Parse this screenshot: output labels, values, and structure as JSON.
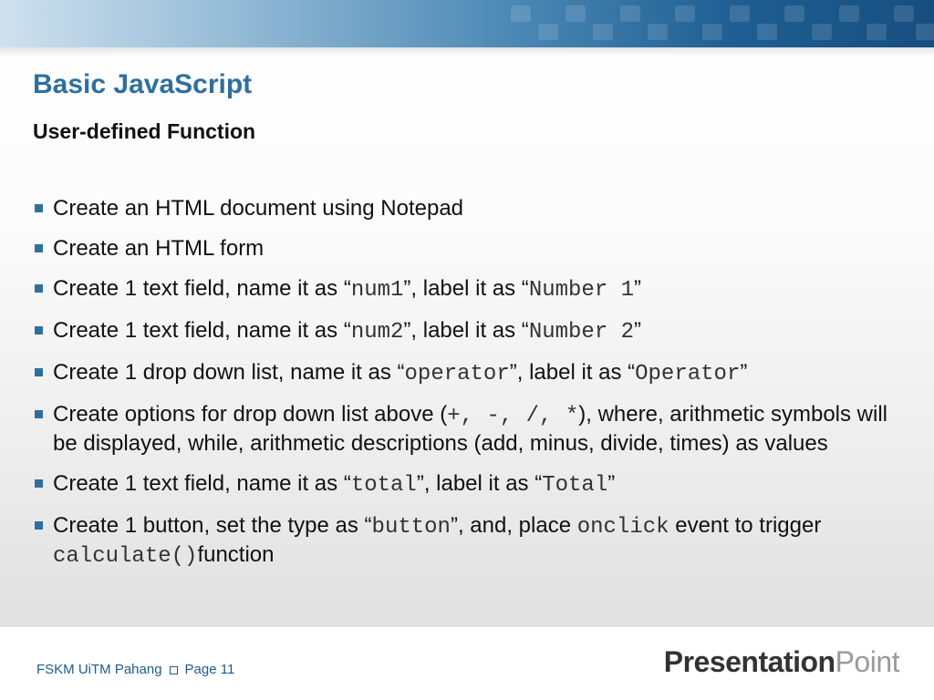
{
  "slide": {
    "title": "Basic JavaScript",
    "subtitle": "User-defined Function",
    "bullets": [
      {
        "segments": [
          {
            "t": "Create an HTML document using Notepad"
          }
        ]
      },
      {
        "segments": [
          {
            "t": "Create an HTML form"
          }
        ]
      },
      {
        "segments": [
          {
            "t": "Create 1 text field, name it as “"
          },
          {
            "t": "num1",
            "code": true
          },
          {
            "t": "”, label it as “"
          },
          {
            "t": "Number 1",
            "code": true
          },
          {
            "t": "”"
          }
        ]
      },
      {
        "segments": [
          {
            "t": "Create 1 text field, name it as “"
          },
          {
            "t": "num2",
            "code": true
          },
          {
            "t": "”, label it as “"
          },
          {
            "t": "Number 2",
            "code": true
          },
          {
            "t": "”"
          }
        ]
      },
      {
        "segments": [
          {
            "t": "Create 1 drop down list, name it as “"
          },
          {
            "t": "operator",
            "code": true
          },
          {
            "t": "”, label it as “"
          },
          {
            "t": "Operator",
            "code": true
          },
          {
            "t": "”"
          }
        ]
      },
      {
        "segments": [
          {
            "t": "Create options for drop down list above ("
          },
          {
            "t": "+, -, /, *",
            "code": true
          },
          {
            "t": "), where, arithmetic symbols will be displayed, while, arithmetic descriptions (add, minus, divide, times) as values"
          }
        ]
      },
      {
        "segments": [
          {
            "t": "Create 1 text field, name it as “"
          },
          {
            "t": "total",
            "code": true
          },
          {
            "t": "”, label it as “"
          },
          {
            "t": "Total",
            "code": true
          },
          {
            "t": "”"
          }
        ]
      },
      {
        "segments": [
          {
            "t": "Create 1 button, set the type as “"
          },
          {
            "t": "button",
            "code": true
          },
          {
            "t": "”, and, place "
          },
          {
            "t": "onclick",
            "code": true
          },
          {
            "t": " event to trigger "
          },
          {
            "t": "calculate()",
            "code": true
          },
          {
            "t": "function"
          }
        ]
      }
    ]
  },
  "footer": {
    "org": "FSKM UiTM Pahang",
    "page": "Page 11",
    "brand_bold": "Presentation",
    "brand_light": "Point"
  },
  "colors": {
    "title": "#2f6f9e",
    "bullet_marker": "#2f6f9e",
    "footer_text": "#1c5b8e"
  }
}
